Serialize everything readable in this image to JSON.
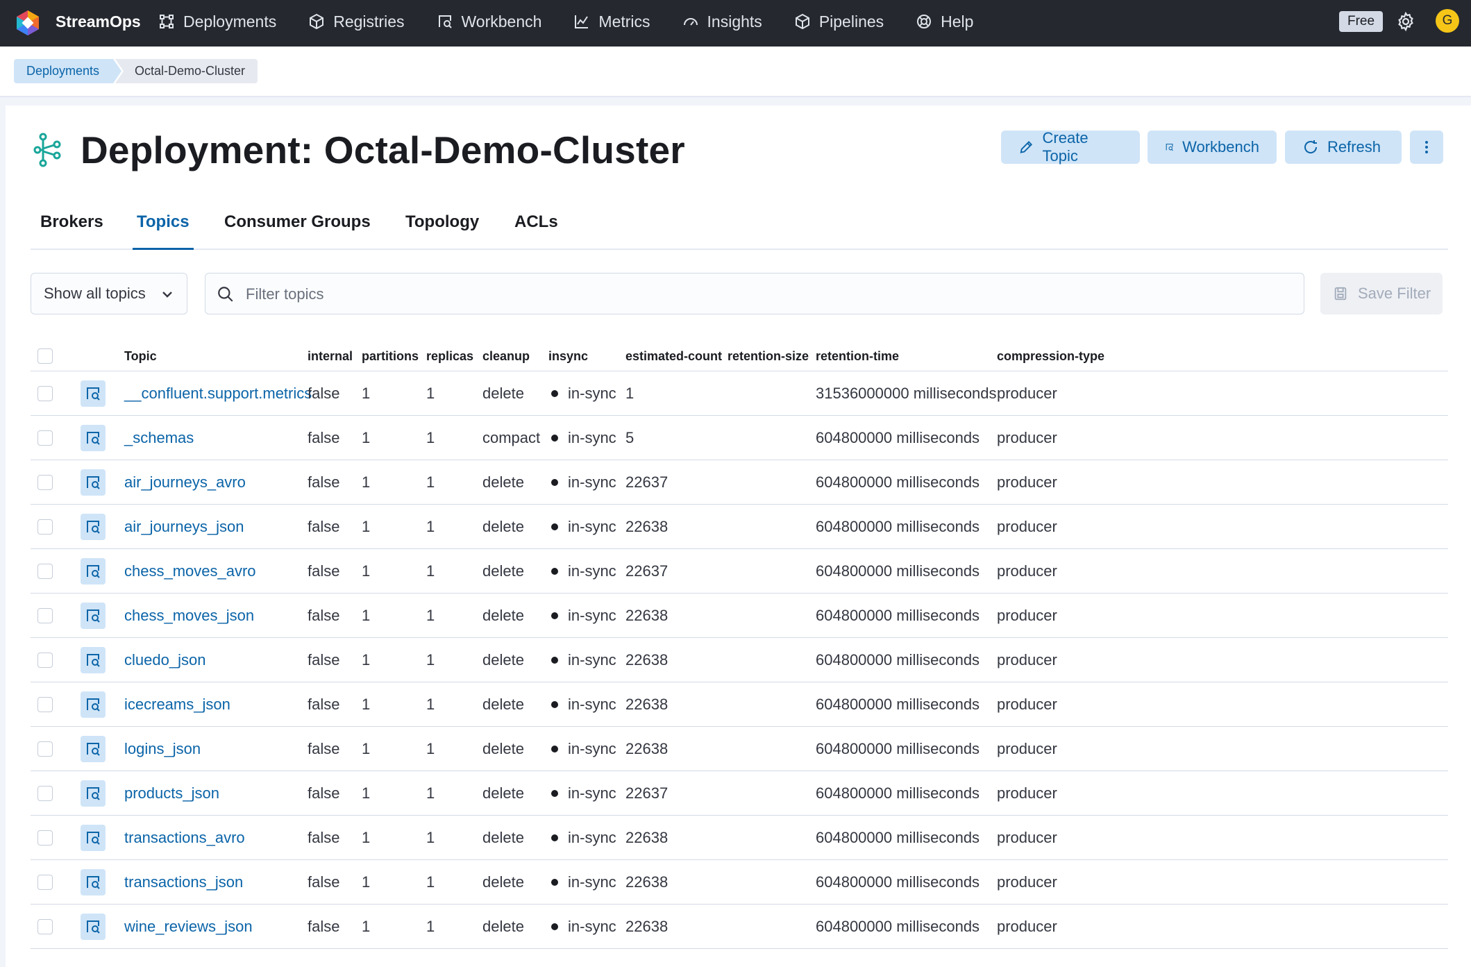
{
  "app": {
    "brand": "StreamOps",
    "plan_badge": "Free",
    "avatar_initial": "G"
  },
  "nav": [
    {
      "label": "Deployments",
      "icon": "deployments-icon"
    },
    {
      "label": "Registries",
      "icon": "cube-icon"
    },
    {
      "label": "Workbench",
      "icon": "workbench-icon"
    },
    {
      "label": "Metrics",
      "icon": "chart-line-icon"
    },
    {
      "label": "Insights",
      "icon": "gauge-icon"
    },
    {
      "label": "Pipelines",
      "icon": "cube-icon"
    },
    {
      "label": "Help",
      "icon": "lifebuoy-icon"
    }
  ],
  "breadcrumb": {
    "root": "Deployments",
    "current": "Octal-Demo-Cluster"
  },
  "page": {
    "title": "Deployment: Octal-Demo-Cluster",
    "actions": {
      "create_topic": "Create Topic",
      "workbench": "Workbench",
      "refresh": "Refresh"
    }
  },
  "tabs": {
    "brokers": "Brokers",
    "topics": "Topics",
    "consumer_groups": "Consumer Groups",
    "topology": "Topology",
    "acls": "ACLs",
    "active": "Topics"
  },
  "filter": {
    "select_value": "Show all topics",
    "search_placeholder": "Filter topics",
    "save_label": "Save Filter"
  },
  "table": {
    "columns": {
      "topic": "Topic",
      "internal": "internal",
      "partitions": "partitions",
      "replicas": "replicas",
      "cleanup": "cleanup",
      "insync": "insync",
      "estimated_count": "estimated-count",
      "retention_size": "retention-size",
      "retention_time": "retention-time",
      "compression_type": "compression-type"
    },
    "rows": [
      {
        "topic": "__confluent.support.metrics",
        "internal": "false",
        "partitions": "1",
        "replicas": "1",
        "cleanup": "delete",
        "insync": "in-sync",
        "estimated_count": "1",
        "retention_size": "",
        "retention_time": "31536000000 milliseconds",
        "compression_type": "producer"
      },
      {
        "topic": "_schemas",
        "internal": "false",
        "partitions": "1",
        "replicas": "1",
        "cleanup": "compact",
        "insync": "in-sync",
        "estimated_count": "5",
        "retention_size": "",
        "retention_time": "604800000 milliseconds",
        "compression_type": "producer"
      },
      {
        "topic": "air_journeys_avro",
        "internal": "false",
        "partitions": "1",
        "replicas": "1",
        "cleanup": "delete",
        "insync": "in-sync",
        "estimated_count": "22637",
        "retention_size": "",
        "retention_time": "604800000 milliseconds",
        "compression_type": "producer"
      },
      {
        "topic": "air_journeys_json",
        "internal": "false",
        "partitions": "1",
        "replicas": "1",
        "cleanup": "delete",
        "insync": "in-sync",
        "estimated_count": "22638",
        "retention_size": "",
        "retention_time": "604800000 milliseconds",
        "compression_type": "producer"
      },
      {
        "topic": "chess_moves_avro",
        "internal": "false",
        "partitions": "1",
        "replicas": "1",
        "cleanup": "delete",
        "insync": "in-sync",
        "estimated_count": "22637",
        "retention_size": "",
        "retention_time": "604800000 milliseconds",
        "compression_type": "producer"
      },
      {
        "topic": "chess_moves_json",
        "internal": "false",
        "partitions": "1",
        "replicas": "1",
        "cleanup": "delete",
        "insync": "in-sync",
        "estimated_count": "22638",
        "retention_size": "",
        "retention_time": "604800000 milliseconds",
        "compression_type": "producer"
      },
      {
        "topic": "cluedo_json",
        "internal": "false",
        "partitions": "1",
        "replicas": "1",
        "cleanup": "delete",
        "insync": "in-sync",
        "estimated_count": "22638",
        "retention_size": "",
        "retention_time": "604800000 milliseconds",
        "compression_type": "producer"
      },
      {
        "topic": "icecreams_json",
        "internal": "false",
        "partitions": "1",
        "replicas": "1",
        "cleanup": "delete",
        "insync": "in-sync",
        "estimated_count": "22638",
        "retention_size": "",
        "retention_time": "604800000 milliseconds",
        "compression_type": "producer"
      },
      {
        "topic": "logins_json",
        "internal": "false",
        "partitions": "1",
        "replicas": "1",
        "cleanup": "delete",
        "insync": "in-sync",
        "estimated_count": "22638",
        "retention_size": "",
        "retention_time": "604800000 milliseconds",
        "compression_type": "producer"
      },
      {
        "topic": "products_json",
        "internal": "false",
        "partitions": "1",
        "replicas": "1",
        "cleanup": "delete",
        "insync": "in-sync",
        "estimated_count": "22637",
        "retention_size": "",
        "retention_time": "604800000 milliseconds",
        "compression_type": "producer"
      },
      {
        "topic": "transactions_avro",
        "internal": "false",
        "partitions": "1",
        "replicas": "1",
        "cleanup": "delete",
        "insync": "in-sync",
        "estimated_count": "22638",
        "retention_size": "",
        "retention_time": "604800000 milliseconds",
        "compression_type": "producer"
      },
      {
        "topic": "transactions_json",
        "internal": "false",
        "partitions": "1",
        "replicas": "1",
        "cleanup": "delete",
        "insync": "in-sync",
        "estimated_count": "22638",
        "retention_size": "",
        "retention_time": "604800000 milliseconds",
        "compression_type": "producer"
      },
      {
        "topic": "wine_reviews_json",
        "internal": "false",
        "partitions": "1",
        "replicas": "1",
        "cleanup": "delete",
        "insync": "in-sync",
        "estimated_count": "22638",
        "retention_size": "",
        "retention_time": "604800000 milliseconds",
        "compression_type": "producer"
      }
    ]
  },
  "colors": {
    "nav_bg": "#25282f",
    "accent": "#0b64a8",
    "accent_soft": "#cfe4f7",
    "title_icon": "#1aa69a"
  }
}
